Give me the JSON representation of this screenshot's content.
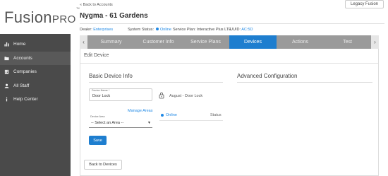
{
  "brand": {
    "main": "Fusion",
    "suffix": "PRO",
    "tm": "™"
  },
  "nav": [
    {
      "label": "Home",
      "icon": "bar-chart-icon"
    },
    {
      "label": "Accounts",
      "icon": "folder-icon"
    },
    {
      "label": "Companies",
      "icon": "building-icon"
    },
    {
      "label": "All Staff",
      "icon": "user-icon"
    },
    {
      "label": "Help Center",
      "icon": "info-icon"
    }
  ],
  "header": {
    "back_link": "« Back to Accounts",
    "legacy_button": "Legacy Fusion",
    "account_title": "Nygma - 61 Gardens"
  },
  "info": {
    "dealer_label": "Dealer:",
    "dealer_value": "Enterprises",
    "system_status_label": "System Status:",
    "system_status_value": "Online",
    "service_plan_label": "Service Plan:",
    "service_plan_value": "Interactive Plus LTE",
    "uuid_label": "UUID:",
    "uuid_value": "AC:5D"
  },
  "tabs": [
    "Summary",
    "Customer Info",
    "Service Plans",
    "Devices",
    "Actions",
    "Test"
  ],
  "active_tab": "Devices",
  "panel": {
    "title": "Edit Device",
    "basic_title": "Basic Device Info",
    "advanced_title": "Advanced Configuration",
    "device_name_label": "Device Name *",
    "device_name_value": "Door Lock",
    "device_display": "August - Door Lock",
    "manage_areas": "Manage Areas",
    "device_area_label": "Device Area",
    "device_area_value": "-- Select an Area --",
    "status_value": "Online",
    "status_label": "Status",
    "save_button": "Save",
    "back_button": "Back to Devices"
  },
  "colors": {
    "accent": "#1e7ecf",
    "sidebar": "#4a4a4a",
    "tabs": "#9a9a9a"
  }
}
